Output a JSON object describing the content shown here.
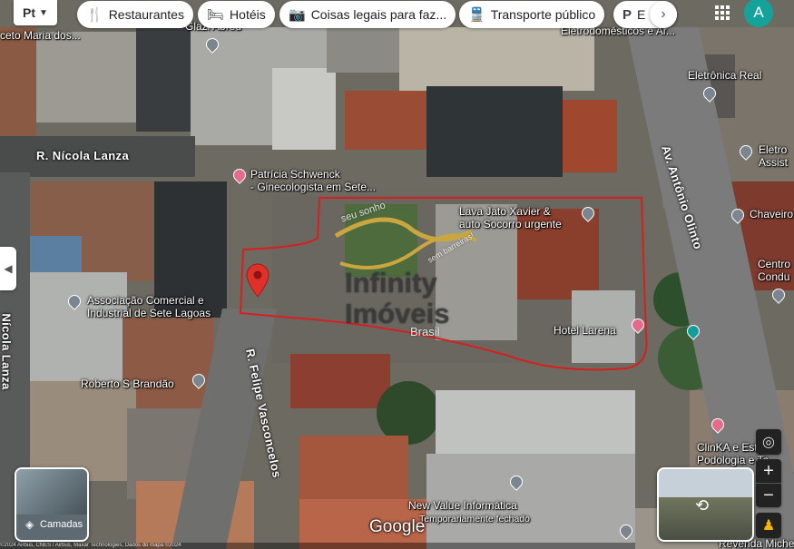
{
  "top_bar": {
    "menu_icon_text": "Pt",
    "chips": [
      {
        "icon": "restaurant-icon",
        "glyph": "🍴",
        "label": "Restaurantes"
      },
      {
        "icon": "hotel-icon",
        "glyph": "🛏",
        "label": "Hotéis"
      },
      {
        "icon": "camera-icon",
        "glyph": "📷",
        "label": "Coisas legais para faz..."
      },
      {
        "icon": "transit-icon",
        "glyph": "🚆",
        "label": "Transporte público"
      },
      {
        "icon": "parking-icon",
        "glyph": "P",
        "label": "E"
      }
    ],
    "avatar_letter": "A",
    "avatar_color": "#14a39a"
  },
  "streets": {
    "nicola_lanza_h": "R. Nícola Lanza",
    "nicola_lanza_v": "Nícola Lanza",
    "felipe": "R. Felipe Vasconcelos",
    "antonio": "Av. Antônio Olinto"
  },
  "places": {
    "maria": "ceto Maria dos...",
    "glaziela": "Glazi Abreu",
    "eletro": "Eletrodomésticos e Ar...",
    "eletronica": "Eletrônica Real",
    "eletro2_l1": "Eletro",
    "eletro2_l2": "Assist",
    "patricia_l1": "Patrícia Schwenck",
    "patricia_l2": "- Ginecologista em Sete...",
    "lava_l1": "Lava Jato Xavier &",
    "lava_l2": "auto Socorro urgente",
    "chaveiro": "Chaveiro",
    "centro_l1": "Centro",
    "centro_l2": "Condu",
    "associacao_l1": "Associação Comercial e",
    "associacao_l2": "Industrial de Sete Lagoas",
    "hotel": "Hotel Larena",
    "roberto": "Roberto S Brandão",
    "clinika_l1": "ClinKA e Esta",
    "clinika_l2": "Podologia e Ta",
    "newvalue_l1": "New Value Informática",
    "newvalue_l2": "Temporariamente fechado",
    "revenda": "Revenda Michelin"
  },
  "watermark": {
    "line1": "Infinity",
    "line2": "Imóveis",
    "sub": "Brasil",
    "curve_top": "seu sonho",
    "curve_right": "sem barreiras!"
  },
  "layers_label": "Camadas",
  "google_logo": "Google",
  "footer_text": "©2024 Airbus, CNES / Airbus, Maxar Technologies, Dados do mapa ©2024",
  "colors": {
    "boundary": "#d6201f",
    "pin_red": "#e0302a"
  }
}
